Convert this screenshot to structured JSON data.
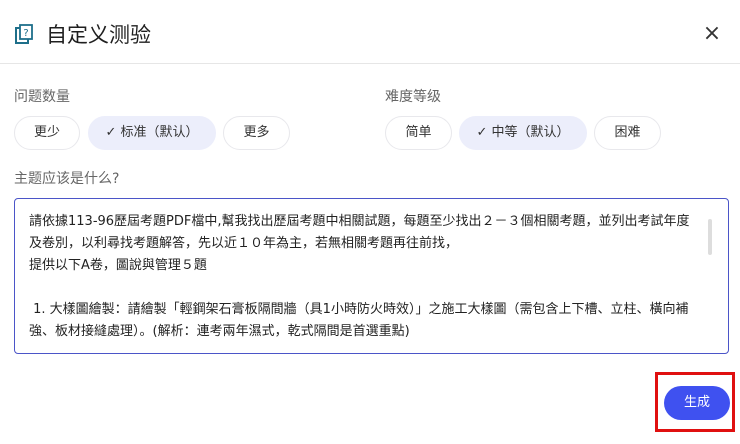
{
  "header": {
    "title": "自定义测验",
    "close_icon": "×"
  },
  "count": {
    "label": "问题数量",
    "options": [
      "更少",
      "✓  标准（默认）",
      "更多"
    ],
    "selected": 1
  },
  "difficulty": {
    "label": "难度等级",
    "options": [
      "简单",
      "✓  中等（默认）",
      "困难"
    ],
    "selected": 1
  },
  "topic": {
    "label": "主题应该是什么?",
    "value": "請依據113-96歷屆考題PDF檔中,幫我找出歷屆考題中相關試題，每題至少找出２－３個相關考題，並列出考試年度及卷別，以利尋找考題解答，先以近１０年為主，若無相關考題再往前找，\n提供以下A卷，圖說與管理５題\n\n 1. 大樣圖繪製：請繪製「輕鋼架石膏板隔間牆（具1小時防火時效）」之施工大樣圖（需包含上下槽、立柱、橫向補強、板材接縫處理）。(解析：連考兩年濕式，乾式隔間是首選重點)"
  },
  "generate_label": "生成",
  "colors": {
    "accent": "#3f51f0",
    "selected_chip": "#eceefb",
    "highlight": "#e01010"
  }
}
